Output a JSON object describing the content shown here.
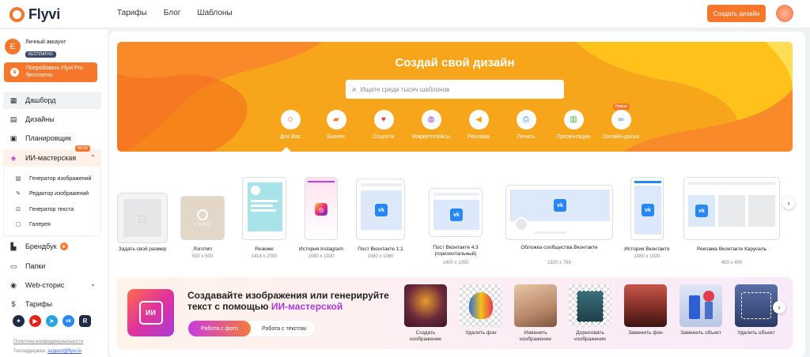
{
  "app": {
    "logo_text": "Flyvi"
  },
  "header": {
    "nav": [
      "Тарифы",
      "Блог",
      "Шаблоны"
    ],
    "create_button": "Создать дизайн"
  },
  "sidebar": {
    "account_initial": "E",
    "account_name": "Личный аккаунт",
    "account_badge": "БЕСПЛАТНО",
    "pro_button": "Попробовать Flyvi Pro бесплатно",
    "items": [
      {
        "label": "Дашборд",
        "icon": "dashboard-icon"
      },
      {
        "label": "Дизайны",
        "icon": "designs-icon"
      },
      {
        "label": "Планировщик",
        "icon": "planner-icon"
      }
    ],
    "ai_section": {
      "label": "ИИ-мастерская",
      "badge": "BETA",
      "sub_items": [
        "Генератор изображений",
        "Редактор изображений",
        "Генератор текста",
        "Галерея"
      ]
    },
    "items_after": [
      {
        "label": "Брендбук",
        "icon": "brandbook-icon"
      },
      {
        "label": "Папки",
        "icon": "folder-icon"
      },
      {
        "label": "Web-сторис",
        "icon": "web-stories-icon"
      },
      {
        "label": "Тарифы",
        "icon": "dollar-icon"
      }
    ],
    "social_icons": [
      "zen-icon",
      "youtube-icon",
      "telegram-icon",
      "vk-icon",
      "rutube-icon"
    ],
    "privacy_link": "Политика конфиденциальности",
    "support_label": "Техподдержка:",
    "support_email": "support@flyvi.io"
  },
  "hero": {
    "title": "Создай свой дизайн",
    "search_placeholder": "Ищите среди тысяч шаблонов",
    "new_badge": "Новое",
    "categories": [
      {
        "label": "Для Вас",
        "icon": "smile-icon",
        "color": "#f4772b"
      },
      {
        "label": "Бизнес",
        "icon": "briefcase-icon",
        "color": "#f4772b"
      },
      {
        "label": "Соцсети",
        "icon": "heart-icon",
        "color": "#e23b4e"
      },
      {
        "label": "Маркетплейсы",
        "icon": "shopping-icon",
        "color": "#8a3cd4"
      },
      {
        "label": "Реклама",
        "icon": "megaphone-icon",
        "color": "#f4a41b"
      },
      {
        "label": "Печать",
        "icon": "printer-icon",
        "color": "#2d8fd5"
      },
      {
        "label": "Презентации",
        "icon": "presentation-icon",
        "color": "#4caf50"
      },
      {
        "label": "Онлайн-доска",
        "icon": "board-icon",
        "color": "#2d8fd5"
      }
    ]
  },
  "templates": [
    {
      "name": "Задать свой размер",
      "size": ""
    },
    {
      "name": "Логотип",
      "size": "500 x 500",
      "logo_text": "LOGO"
    },
    {
      "name": "Резюме",
      "size": "1414 x 2000"
    },
    {
      "name": "История Instagram",
      "size": "1080 x 1920"
    },
    {
      "name": "Пост Вконтакте 1:1",
      "size": "1080 x 1080"
    },
    {
      "name": "Пост Вконтакте 4:3 (горизонтальный)",
      "size": "1400 x 1050"
    },
    {
      "name": "Обложка сообщества Вконтакте",
      "size": "1920 x 768"
    },
    {
      "name": "История Вконтакте",
      "size": "1080 x 1920"
    },
    {
      "name": "Реклама Вконтакте Карусель",
      "size": "400 x 400"
    }
  ],
  "ai_banner": {
    "chip_label": "ИИ",
    "title_part1": "Создавайте изображения или генерируйте текст с помощью ",
    "title_highlight": "ИИ-мастерской",
    "toggle_active": "Работа с фото",
    "toggle_inactive": "Работа с текстом",
    "tools": [
      "Создать изображение",
      "Удалить фон",
      "Изменить изображение",
      "Дорисовать изображение",
      "Заменить фон",
      "Заменить объект",
      "Удалить объект"
    ]
  },
  "colors": {
    "accent": "#f4772b",
    "hero": "#f7a51b",
    "vk": "#2787f5",
    "ai_purple": "#a93cd4"
  }
}
